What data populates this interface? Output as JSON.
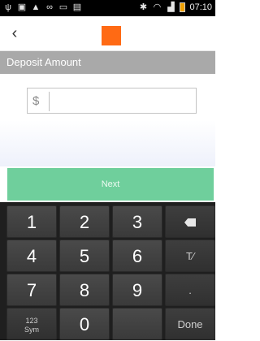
{
  "status_bar": {
    "left_icons": [
      "usb-icon",
      "image-icon",
      "warning-icon",
      "voicemail-icon",
      "mail-icon",
      "file-icon"
    ],
    "right_icons": [
      "bluetooth-icon",
      "wifi-icon",
      "signal-icon",
      "battery-icon"
    ],
    "time": "07:10"
  },
  "app_bar": {
    "back_glyph": "‹",
    "logo_color": "#ff6a14"
  },
  "section": {
    "title": "Deposit Amount"
  },
  "amount": {
    "currency_symbol": "$",
    "value": "",
    "placeholder": ""
  },
  "next_button": {
    "label": "Next",
    "color": "#6fcf9c"
  },
  "keyboard": {
    "row1": [
      "1",
      "2",
      "3"
    ],
    "row2": [
      "4",
      "5",
      "6"
    ],
    "row3": [
      "7",
      "8",
      "9"
    ],
    "sym_label_top": "123",
    "sym_label_bottom": "Sym",
    "zero": "0",
    "done": "Done",
    "dot": ".",
    "cursor_glyph": "T⁄"
  }
}
